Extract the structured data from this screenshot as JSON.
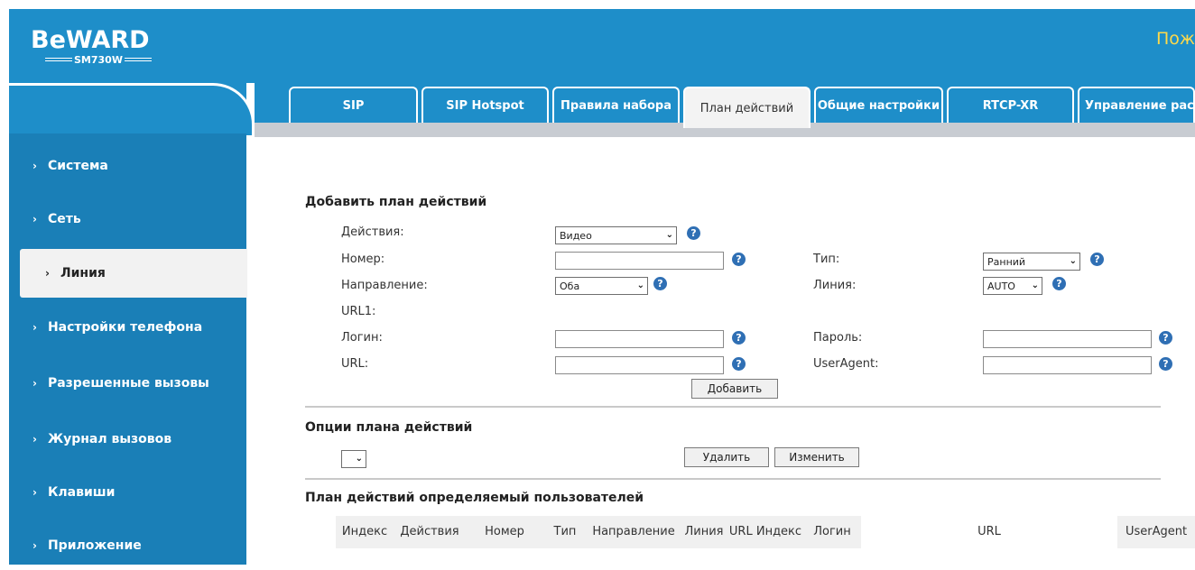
{
  "brand": {
    "logo": "BeWARD",
    "model": "SM730W",
    "welcome": "Пож"
  },
  "sidebar": {
    "items": [
      {
        "label": "Система"
      },
      {
        "label": "Сеть"
      },
      {
        "label": "Линия"
      },
      {
        "label": "Настройки телефона"
      },
      {
        "label": "Разрешенные вызовы"
      },
      {
        "label": "Журнал вызовов"
      },
      {
        "label": "Клавиши"
      },
      {
        "label": "Приложение"
      }
    ],
    "active_index": 2
  },
  "tabs": [
    {
      "label": "SIP"
    },
    {
      "label": "SIP Hotspot"
    },
    {
      "label": "Правила набора"
    },
    {
      "label": "План действий"
    },
    {
      "label": "Общие настройки"
    },
    {
      "label": "RTCP-XR"
    },
    {
      "label": "Управление рас"
    }
  ],
  "add_plan": {
    "title": "Добавить план действий",
    "action_label": "Действия:",
    "action_value": "Видео",
    "number_label": "Номер:",
    "number_value": "",
    "type_label": "Тип:",
    "type_value": "Ранний",
    "direction_label": "Направление:",
    "direction_value": "Оба",
    "line_label": "Линия:",
    "line_value": "AUTO",
    "url1_label": "URL1:",
    "login_label": "Логин:",
    "login_value": "",
    "password_label": "Пароль:",
    "password_value": "",
    "url_label": "URL:",
    "url_value": "",
    "useragent_label": "UserAgent:",
    "useragent_value": "",
    "add_button": "Добавить"
  },
  "options": {
    "title": "Опции плана действий",
    "select_value": "",
    "delete_button": "Удалить",
    "edit_button": "Изменить"
  },
  "user_plan": {
    "title": "План действий определяемый пользователей",
    "columns": [
      "Индекс",
      "Действия",
      "Номер",
      "Тип",
      "Направление",
      "Линия",
      "URL Индекс",
      "Логин",
      "URL",
      "UserAgent"
    ]
  },
  "help_glyph": "?",
  "colors": {
    "header": "#1e8ec9",
    "accent": "#ffd94a",
    "help": "#2f6fb4"
  }
}
